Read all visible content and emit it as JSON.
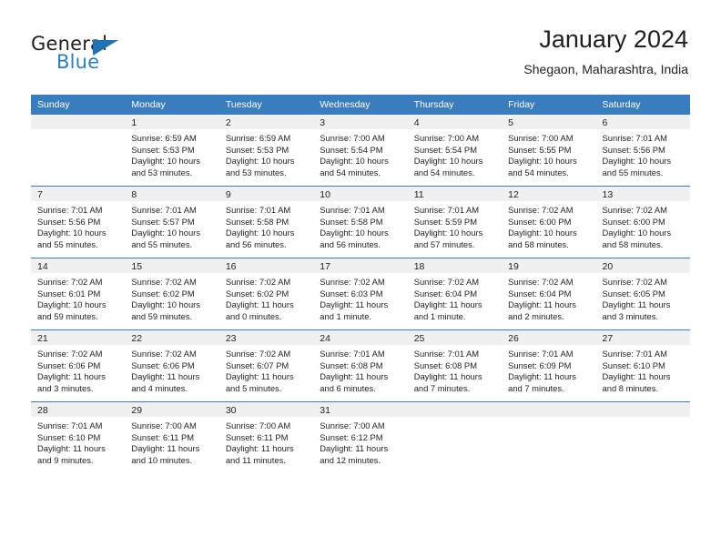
{
  "logo": {
    "line1": "General",
    "line2": "Blue",
    "triangle_color": "#1f73b7",
    "text_color": "#231f20",
    "blue_text_color": "#2a7fc1"
  },
  "header": {
    "title": "January 2024",
    "subtitle": "Shegaon, Maharashtra, India"
  },
  "theme": {
    "header_row_bg": "#3a7dbf",
    "header_row_text": "#ffffff",
    "daynum_band_bg": "#f0f0f0",
    "cell_bg": "#ffffff",
    "text": "#231f20"
  },
  "calendar": {
    "weekday_headers": [
      "Sunday",
      "Monday",
      "Tuesday",
      "Wednesday",
      "Thursday",
      "Friday",
      "Saturday"
    ],
    "weeks": [
      [
        {
          "day": "",
          "sunrise": "",
          "sunset": "",
          "daylight_line1": "",
          "daylight_line2": ""
        },
        {
          "day": "1",
          "sunrise": "Sunrise: 6:59 AM",
          "sunset": "Sunset: 5:53 PM",
          "daylight_line1": "Daylight: 10 hours",
          "daylight_line2": "and 53 minutes."
        },
        {
          "day": "2",
          "sunrise": "Sunrise: 6:59 AM",
          "sunset": "Sunset: 5:53 PM",
          "daylight_line1": "Daylight: 10 hours",
          "daylight_line2": "and 53 minutes."
        },
        {
          "day": "3",
          "sunrise": "Sunrise: 7:00 AM",
          "sunset": "Sunset: 5:54 PM",
          "daylight_line1": "Daylight: 10 hours",
          "daylight_line2": "and 54 minutes."
        },
        {
          "day": "4",
          "sunrise": "Sunrise: 7:00 AM",
          "sunset": "Sunset: 5:54 PM",
          "daylight_line1": "Daylight: 10 hours",
          "daylight_line2": "and 54 minutes."
        },
        {
          "day": "5",
          "sunrise": "Sunrise: 7:00 AM",
          "sunset": "Sunset: 5:55 PM",
          "daylight_line1": "Daylight: 10 hours",
          "daylight_line2": "and 54 minutes."
        },
        {
          "day": "6",
          "sunrise": "Sunrise: 7:01 AM",
          "sunset": "Sunset: 5:56 PM",
          "daylight_line1": "Daylight: 10 hours",
          "daylight_line2": "and 55 minutes."
        }
      ],
      [
        {
          "day": "7",
          "sunrise": "Sunrise: 7:01 AM",
          "sunset": "Sunset: 5:56 PM",
          "daylight_line1": "Daylight: 10 hours",
          "daylight_line2": "and 55 minutes."
        },
        {
          "day": "8",
          "sunrise": "Sunrise: 7:01 AM",
          "sunset": "Sunset: 5:57 PM",
          "daylight_line1": "Daylight: 10 hours",
          "daylight_line2": "and 55 minutes."
        },
        {
          "day": "9",
          "sunrise": "Sunrise: 7:01 AM",
          "sunset": "Sunset: 5:58 PM",
          "daylight_line1": "Daylight: 10 hours",
          "daylight_line2": "and 56 minutes."
        },
        {
          "day": "10",
          "sunrise": "Sunrise: 7:01 AM",
          "sunset": "Sunset: 5:58 PM",
          "daylight_line1": "Daylight: 10 hours",
          "daylight_line2": "and 56 minutes."
        },
        {
          "day": "11",
          "sunrise": "Sunrise: 7:01 AM",
          "sunset": "Sunset: 5:59 PM",
          "daylight_line1": "Daylight: 10 hours",
          "daylight_line2": "and 57 minutes."
        },
        {
          "day": "12",
          "sunrise": "Sunrise: 7:02 AM",
          "sunset": "Sunset: 6:00 PM",
          "daylight_line1": "Daylight: 10 hours",
          "daylight_line2": "and 58 minutes."
        },
        {
          "day": "13",
          "sunrise": "Sunrise: 7:02 AM",
          "sunset": "Sunset: 6:00 PM",
          "daylight_line1": "Daylight: 10 hours",
          "daylight_line2": "and 58 minutes."
        }
      ],
      [
        {
          "day": "14",
          "sunrise": "Sunrise: 7:02 AM",
          "sunset": "Sunset: 6:01 PM",
          "daylight_line1": "Daylight: 10 hours",
          "daylight_line2": "and 59 minutes."
        },
        {
          "day": "15",
          "sunrise": "Sunrise: 7:02 AM",
          "sunset": "Sunset: 6:02 PM",
          "daylight_line1": "Daylight: 10 hours",
          "daylight_line2": "and 59 minutes."
        },
        {
          "day": "16",
          "sunrise": "Sunrise: 7:02 AM",
          "sunset": "Sunset: 6:02 PM",
          "daylight_line1": "Daylight: 11 hours",
          "daylight_line2": "and 0 minutes."
        },
        {
          "day": "17",
          "sunrise": "Sunrise: 7:02 AM",
          "sunset": "Sunset: 6:03 PM",
          "daylight_line1": "Daylight: 11 hours",
          "daylight_line2": "and 1 minute."
        },
        {
          "day": "18",
          "sunrise": "Sunrise: 7:02 AM",
          "sunset": "Sunset: 6:04 PM",
          "daylight_line1": "Daylight: 11 hours",
          "daylight_line2": "and 1 minute."
        },
        {
          "day": "19",
          "sunrise": "Sunrise: 7:02 AM",
          "sunset": "Sunset: 6:04 PM",
          "daylight_line1": "Daylight: 11 hours",
          "daylight_line2": "and 2 minutes."
        },
        {
          "day": "20",
          "sunrise": "Sunrise: 7:02 AM",
          "sunset": "Sunset: 6:05 PM",
          "daylight_line1": "Daylight: 11 hours",
          "daylight_line2": "and 3 minutes."
        }
      ],
      [
        {
          "day": "21",
          "sunrise": "Sunrise: 7:02 AM",
          "sunset": "Sunset: 6:06 PM",
          "daylight_line1": "Daylight: 11 hours",
          "daylight_line2": "and 3 minutes."
        },
        {
          "day": "22",
          "sunrise": "Sunrise: 7:02 AM",
          "sunset": "Sunset: 6:06 PM",
          "daylight_line1": "Daylight: 11 hours",
          "daylight_line2": "and 4 minutes."
        },
        {
          "day": "23",
          "sunrise": "Sunrise: 7:02 AM",
          "sunset": "Sunset: 6:07 PM",
          "daylight_line1": "Daylight: 11 hours",
          "daylight_line2": "and 5 minutes."
        },
        {
          "day": "24",
          "sunrise": "Sunrise: 7:01 AM",
          "sunset": "Sunset: 6:08 PM",
          "daylight_line1": "Daylight: 11 hours",
          "daylight_line2": "and 6 minutes."
        },
        {
          "day": "25",
          "sunrise": "Sunrise: 7:01 AM",
          "sunset": "Sunset: 6:08 PM",
          "daylight_line1": "Daylight: 11 hours",
          "daylight_line2": "and 7 minutes."
        },
        {
          "day": "26",
          "sunrise": "Sunrise: 7:01 AM",
          "sunset": "Sunset: 6:09 PM",
          "daylight_line1": "Daylight: 11 hours",
          "daylight_line2": "and 7 minutes."
        },
        {
          "day": "27",
          "sunrise": "Sunrise: 7:01 AM",
          "sunset": "Sunset: 6:10 PM",
          "daylight_line1": "Daylight: 11 hours",
          "daylight_line2": "and 8 minutes."
        }
      ],
      [
        {
          "day": "28",
          "sunrise": "Sunrise: 7:01 AM",
          "sunset": "Sunset: 6:10 PM",
          "daylight_line1": "Daylight: 11 hours",
          "daylight_line2": "and 9 minutes."
        },
        {
          "day": "29",
          "sunrise": "Sunrise: 7:00 AM",
          "sunset": "Sunset: 6:11 PM",
          "daylight_line1": "Daylight: 11 hours",
          "daylight_line2": "and 10 minutes."
        },
        {
          "day": "30",
          "sunrise": "Sunrise: 7:00 AM",
          "sunset": "Sunset: 6:11 PM",
          "daylight_line1": "Daylight: 11 hours",
          "daylight_line2": "and 11 minutes."
        },
        {
          "day": "31",
          "sunrise": "Sunrise: 7:00 AM",
          "sunset": "Sunset: 6:12 PM",
          "daylight_line1": "Daylight: 11 hours",
          "daylight_line2": "and 12 minutes."
        },
        {
          "day": "",
          "sunrise": "",
          "sunset": "",
          "daylight_line1": "",
          "daylight_line2": ""
        },
        {
          "day": "",
          "sunrise": "",
          "sunset": "",
          "daylight_line1": "",
          "daylight_line2": ""
        },
        {
          "day": "",
          "sunrise": "",
          "sunset": "",
          "daylight_line1": "",
          "daylight_line2": ""
        }
      ]
    ]
  }
}
